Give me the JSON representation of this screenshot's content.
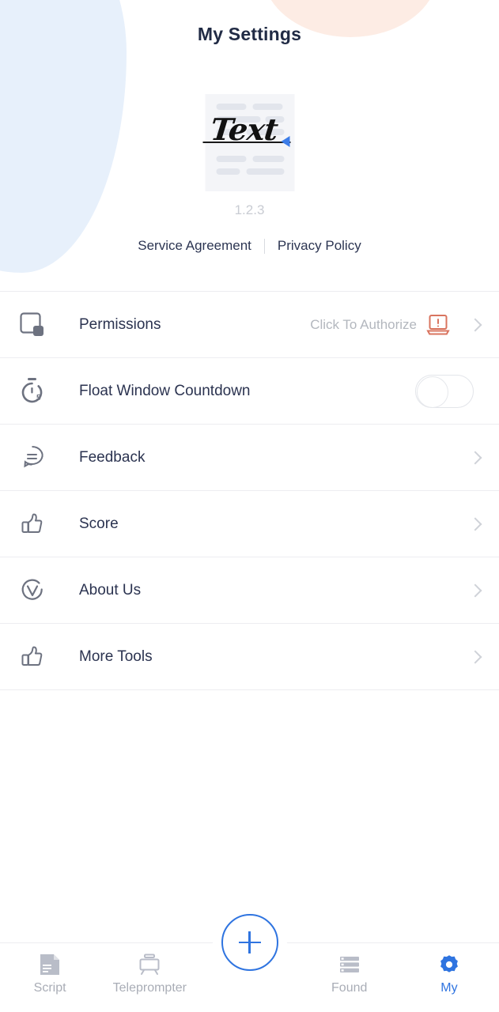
{
  "header": {
    "title": "My Settings"
  },
  "theme": {
    "accent": "#2f74e0",
    "blob_blue": "#e7f0fb",
    "blob_peach": "#fdece4",
    "title_color": "#212b45",
    "warning_color": "#d9745f",
    "muted_text": "#b3b7be"
  },
  "logo": {
    "text": "Text",
    "icon_name": "text-document-logo",
    "marker_icon": "blue-triangle-marker"
  },
  "version": "1.2.3",
  "links": [
    {
      "label": "Service Agreement",
      "name": "service-agreement-link"
    },
    {
      "label": "Privacy Policy",
      "name": "privacy-policy-link"
    }
  ],
  "settings": [
    {
      "label": "Permissions",
      "icon": "permissions-square-icon",
      "value": "Click To Authorize",
      "warning_icon": "laptop-warning-icon",
      "control": "chevron",
      "name": "settings-row-permissions"
    },
    {
      "label": "Float Window Countdown",
      "icon": "stopwatch-countdown-icon",
      "value": "",
      "control": "toggle",
      "toggle_on": false,
      "name": "settings-row-float-window-countdown"
    },
    {
      "label": "Feedback",
      "icon": "speech-bubble-icon",
      "value": "",
      "control": "chevron",
      "name": "settings-row-feedback"
    },
    {
      "label": "Score",
      "icon": "thumbs-up-icon",
      "value": "",
      "control": "chevron",
      "name": "settings-row-score"
    },
    {
      "label": "About Us",
      "icon": "circle-check-icon",
      "value": "",
      "control": "chevron",
      "name": "settings-row-about-us"
    },
    {
      "label": "More Tools",
      "icon": "thumbs-up-icon",
      "value": "",
      "control": "chevron",
      "name": "settings-row-more-tools"
    }
  ],
  "tabbar": {
    "tabs": [
      {
        "label": "Script",
        "icon": "script-document-icon",
        "active": false
      },
      {
        "label": "Teleprompter",
        "icon": "teleprompter-icon",
        "active": false
      },
      {
        "label": "",
        "icon": "plus-circle-icon",
        "active": false
      },
      {
        "label": "Found",
        "icon": "list-rows-icon",
        "active": false
      },
      {
        "label": "My",
        "icon": "gear-icon",
        "active": true
      }
    ],
    "add_button_label": "+"
  }
}
